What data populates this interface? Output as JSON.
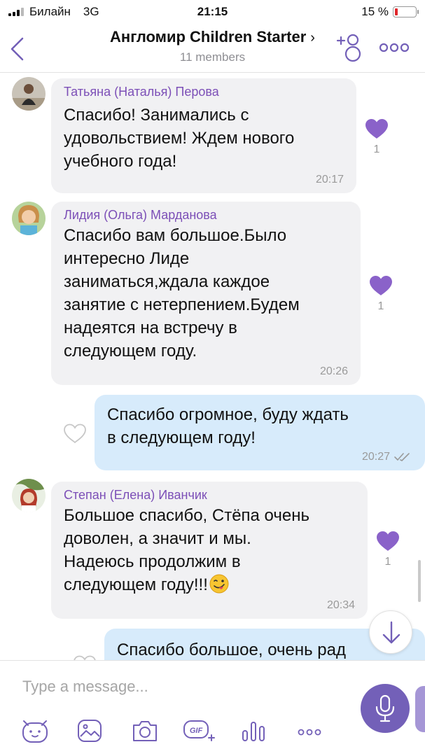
{
  "status_bar": {
    "carrier": "Билайн",
    "network": "3G",
    "time": "21:15",
    "battery_text": "15 %",
    "battery_level": 0.15,
    "battery_color": "#e0262b"
  },
  "header": {
    "title": "Англомир Children Starter",
    "title_chevron": "›",
    "subtitle": "11 members",
    "icons": [
      "back-arrow-icon",
      "add-member-icon",
      "more-options-icon"
    ]
  },
  "messages": [
    {
      "type": "incoming",
      "sender": "Татьяна (Наталья) Перова",
      "lines": [
        "Спасибо! Занимались с",
        "удовольствием! Ждем нового",
        "учебного года!"
      ],
      "time": "20:17",
      "likes": "1"
    },
    {
      "type": "incoming",
      "sender": "Лидия (Ольга) Марданова",
      "lines": [
        "Спасибо вам большое.Было",
        "интересно Лиде",
        "заниматься,ждала каждое",
        "занятие с нетерпением.Будем",
        "надеятся на встречу в",
        "следующем году."
      ],
      "time": "20:26",
      "likes": "1"
    },
    {
      "type": "outgoing",
      "lines": [
        "Спасибо огромное, буду ждать",
        "в следующем году!"
      ],
      "time": "20:27",
      "status": "read"
    },
    {
      "type": "incoming",
      "sender": "Степан (Елена) Иванчик",
      "lines": [
        "Большое спасибо, Стёпа очень",
        "доволен, а значит и мы.",
        "Надеюсь продолжим в",
        "следующем году!!!"
      ],
      "time": "20:34",
      "likes": "1",
      "emoji": "winking-tongue-emoji"
    },
    {
      "type": "outgoing",
      "lines": [
        "Спасибо большое, очень рад"
      ]
    }
  ],
  "composer": {
    "placeholder": "Type a message...",
    "toolbar": [
      "sticker-icon",
      "gallery-icon",
      "camera-icon",
      "gif-icon",
      "voice-bars-icon",
      "more-icon"
    ],
    "gif_label": "GIF"
  },
  "colors": {
    "accent": "#7360b8",
    "sender_name": "#7c4fb7",
    "incoming_bubble": "#f1f1f3",
    "outgoing_bubble": "#d7ebfb",
    "like": "#8a62c9"
  }
}
